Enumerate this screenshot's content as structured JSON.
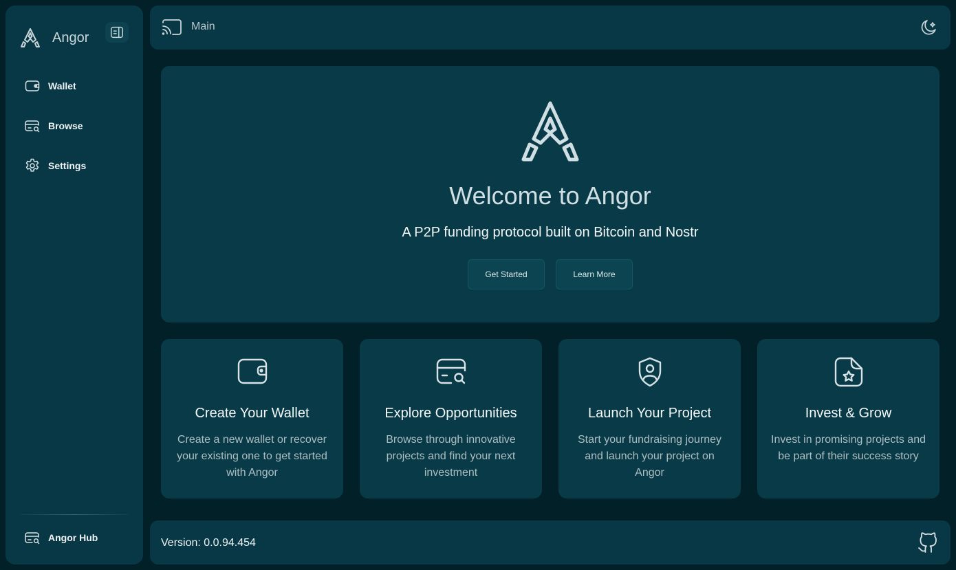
{
  "colors": {
    "background": "#022028",
    "panel": "#083845",
    "text": "#eef4f5",
    "muted_text": "#aebfc3"
  },
  "sidebar": {
    "brand": "Angor",
    "items": [
      {
        "label": "Wallet",
        "icon": "wallet-icon"
      },
      {
        "label": "Browse",
        "icon": "browse-icon"
      },
      {
        "label": "Settings",
        "icon": "gear-icon"
      }
    ],
    "hub": {
      "label": "Angor Hub",
      "icon": "hub-icon"
    }
  },
  "topbar": {
    "breadcrumb": "Main",
    "left_icon": "cast-icon",
    "right_icon": "theme-toggle-icon"
  },
  "hero": {
    "title": "Welcome to Angor",
    "subtitle": "A P2P funding protocol built on Bitcoin and Nostr",
    "primary_button": "Get Started",
    "secondary_button": "Learn More"
  },
  "cards": [
    {
      "title": "Create Your Wallet",
      "description": "Create a new wallet or recover your existing one to get started with Angor",
      "icon": "wallet-icon"
    },
    {
      "title": "Explore Opportunities",
      "description": "Browse through innovative projects and find your next investment",
      "icon": "browse-icon"
    },
    {
      "title": "Launch Your Project",
      "description": "Start your fundraising journey and launch your project on Angor",
      "icon": "shield-user-icon"
    },
    {
      "title": "Invest & Grow",
      "description": "Invest in promising projects and be part of their success story",
      "icon": "document-star-icon"
    }
  ],
  "footer": {
    "version": "Version: 0.0.94.454",
    "right_icon": "github-icon"
  }
}
